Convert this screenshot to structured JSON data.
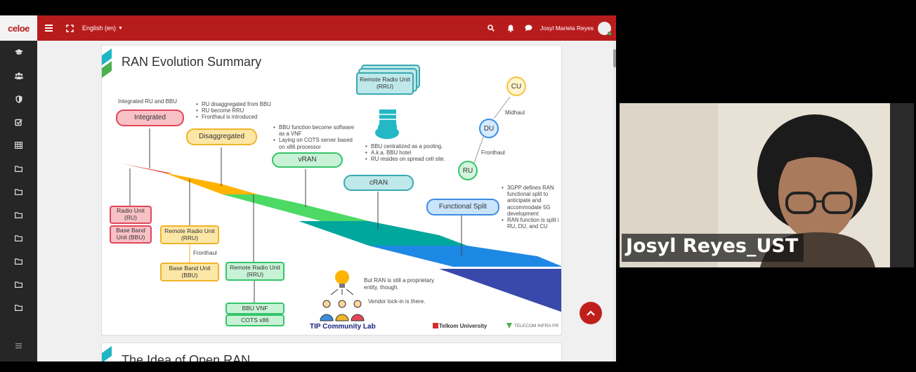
{
  "topbar": {
    "logo_text": "celoe",
    "language": "English (en)",
    "user_name": "Josyl Mariela Reyes",
    "accent_color": "#b71c1c"
  },
  "sidebar": {
    "items": [
      {
        "icon": "graduation-cap-icon"
      },
      {
        "icon": "users-icon"
      },
      {
        "icon": "shield-icon"
      },
      {
        "icon": "checkbox-icon"
      },
      {
        "icon": "table-icon"
      },
      {
        "icon": "folder-icon"
      },
      {
        "icon": "folder-icon"
      },
      {
        "icon": "folder-icon"
      },
      {
        "icon": "folder-icon"
      },
      {
        "icon": "folder-icon"
      },
      {
        "icon": "folder-icon"
      },
      {
        "icon": "folder-icon"
      }
    ]
  },
  "slide1": {
    "title": "RAN Evolution Summary",
    "integrated_caption": "Integrated RU and BBU",
    "integrated": "Integrated",
    "disaggregated": "Disaggregated",
    "disaggregated_bullets": [
      "RU disaggregated from BBU",
      "RU become RRU",
      "Fronthaul is introduced"
    ],
    "vran": "vRAN",
    "vran_bullets": [
      "BBU function become software as a VNF",
      "Laying on COTS server based on x86 processor"
    ],
    "cran": "cRAN",
    "cran_bullets": [
      "BBU centralized as a pooling.",
      "A.k.a. BBU hotel",
      "RU resides on spread cell site."
    ],
    "rrh_stack": "Remote Radio Unit (RRU)",
    "functional_split": "Functional Split",
    "fs_bullets": [
      "3GPP defines RAN functional split to anticipate and accommodate 5G development",
      "RAN function is split i RU, DU, and  CU"
    ],
    "cu": "CU",
    "du": "DU",
    "ru": "RU",
    "midhaul": "Midhaul",
    "fronthaul_top": "Fronthaul",
    "radio_unit": "Radio Unit (RU)",
    "bbu_unit": "Base Band Unit (BBU)",
    "rru_yellow": "Remote Radio Unit (RRU)",
    "fronthaul_label": "Fronthaul",
    "bbu_yellow": "Base Band Unit (BBU)",
    "rru_green": "Remote Radio Unit (RRU)",
    "bbu_vnf": "BBU VNF",
    "cots": "COTS x86",
    "proprietary_note": "But RAN is still a proprietary entity, though.",
    "vendor_note": "Vendor lock-in is there.",
    "tip_lab": "TIP Community Lab",
    "telkom": "Telkom University",
    "tip_infra": "TELECOM INFRA PR"
  },
  "slide2": {
    "title": "The Idea of Open RAN"
  },
  "webcam": {
    "name_label": "Josyl Reyes_UST"
  }
}
